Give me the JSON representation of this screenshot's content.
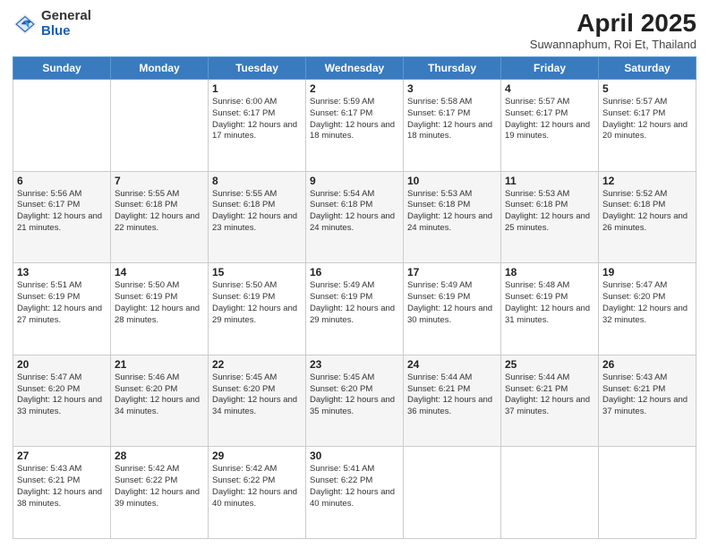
{
  "logo": {
    "general": "General",
    "blue": "Blue"
  },
  "header": {
    "title": "April 2025",
    "subtitle": "Suwannaphum, Roi Et, Thailand"
  },
  "weekdays": [
    "Sunday",
    "Monday",
    "Tuesday",
    "Wednesday",
    "Thursday",
    "Friday",
    "Saturday"
  ],
  "weeks": [
    [
      {
        "day": "",
        "info": ""
      },
      {
        "day": "",
        "info": ""
      },
      {
        "day": "1",
        "info": "Sunrise: 6:00 AM\nSunset: 6:17 PM\nDaylight: 12 hours and 17 minutes."
      },
      {
        "day": "2",
        "info": "Sunrise: 5:59 AM\nSunset: 6:17 PM\nDaylight: 12 hours and 18 minutes."
      },
      {
        "day": "3",
        "info": "Sunrise: 5:58 AM\nSunset: 6:17 PM\nDaylight: 12 hours and 18 minutes."
      },
      {
        "day": "4",
        "info": "Sunrise: 5:57 AM\nSunset: 6:17 PM\nDaylight: 12 hours and 19 minutes."
      },
      {
        "day": "5",
        "info": "Sunrise: 5:57 AM\nSunset: 6:17 PM\nDaylight: 12 hours and 20 minutes."
      }
    ],
    [
      {
        "day": "6",
        "info": "Sunrise: 5:56 AM\nSunset: 6:17 PM\nDaylight: 12 hours and 21 minutes."
      },
      {
        "day": "7",
        "info": "Sunrise: 5:55 AM\nSunset: 6:18 PM\nDaylight: 12 hours and 22 minutes."
      },
      {
        "day": "8",
        "info": "Sunrise: 5:55 AM\nSunset: 6:18 PM\nDaylight: 12 hours and 23 minutes."
      },
      {
        "day": "9",
        "info": "Sunrise: 5:54 AM\nSunset: 6:18 PM\nDaylight: 12 hours and 24 minutes."
      },
      {
        "day": "10",
        "info": "Sunrise: 5:53 AM\nSunset: 6:18 PM\nDaylight: 12 hours and 24 minutes."
      },
      {
        "day": "11",
        "info": "Sunrise: 5:53 AM\nSunset: 6:18 PM\nDaylight: 12 hours and 25 minutes."
      },
      {
        "day": "12",
        "info": "Sunrise: 5:52 AM\nSunset: 6:18 PM\nDaylight: 12 hours and 26 minutes."
      }
    ],
    [
      {
        "day": "13",
        "info": "Sunrise: 5:51 AM\nSunset: 6:19 PM\nDaylight: 12 hours and 27 minutes."
      },
      {
        "day": "14",
        "info": "Sunrise: 5:50 AM\nSunset: 6:19 PM\nDaylight: 12 hours and 28 minutes."
      },
      {
        "day": "15",
        "info": "Sunrise: 5:50 AM\nSunset: 6:19 PM\nDaylight: 12 hours and 29 minutes."
      },
      {
        "day": "16",
        "info": "Sunrise: 5:49 AM\nSunset: 6:19 PM\nDaylight: 12 hours and 29 minutes."
      },
      {
        "day": "17",
        "info": "Sunrise: 5:49 AM\nSunset: 6:19 PM\nDaylight: 12 hours and 30 minutes."
      },
      {
        "day": "18",
        "info": "Sunrise: 5:48 AM\nSunset: 6:19 PM\nDaylight: 12 hours and 31 minutes."
      },
      {
        "day": "19",
        "info": "Sunrise: 5:47 AM\nSunset: 6:20 PM\nDaylight: 12 hours and 32 minutes."
      }
    ],
    [
      {
        "day": "20",
        "info": "Sunrise: 5:47 AM\nSunset: 6:20 PM\nDaylight: 12 hours and 33 minutes."
      },
      {
        "day": "21",
        "info": "Sunrise: 5:46 AM\nSunset: 6:20 PM\nDaylight: 12 hours and 34 minutes."
      },
      {
        "day": "22",
        "info": "Sunrise: 5:45 AM\nSunset: 6:20 PM\nDaylight: 12 hours and 34 minutes."
      },
      {
        "day": "23",
        "info": "Sunrise: 5:45 AM\nSunset: 6:20 PM\nDaylight: 12 hours and 35 minutes."
      },
      {
        "day": "24",
        "info": "Sunrise: 5:44 AM\nSunset: 6:21 PM\nDaylight: 12 hours and 36 minutes."
      },
      {
        "day": "25",
        "info": "Sunrise: 5:44 AM\nSunset: 6:21 PM\nDaylight: 12 hours and 37 minutes."
      },
      {
        "day": "26",
        "info": "Sunrise: 5:43 AM\nSunset: 6:21 PM\nDaylight: 12 hours and 37 minutes."
      }
    ],
    [
      {
        "day": "27",
        "info": "Sunrise: 5:43 AM\nSunset: 6:21 PM\nDaylight: 12 hours and 38 minutes."
      },
      {
        "day": "28",
        "info": "Sunrise: 5:42 AM\nSunset: 6:22 PM\nDaylight: 12 hours and 39 minutes."
      },
      {
        "day": "29",
        "info": "Sunrise: 5:42 AM\nSunset: 6:22 PM\nDaylight: 12 hours and 40 minutes."
      },
      {
        "day": "30",
        "info": "Sunrise: 5:41 AM\nSunset: 6:22 PM\nDaylight: 12 hours and 40 minutes."
      },
      {
        "day": "",
        "info": ""
      },
      {
        "day": "",
        "info": ""
      },
      {
        "day": "",
        "info": ""
      }
    ]
  ]
}
